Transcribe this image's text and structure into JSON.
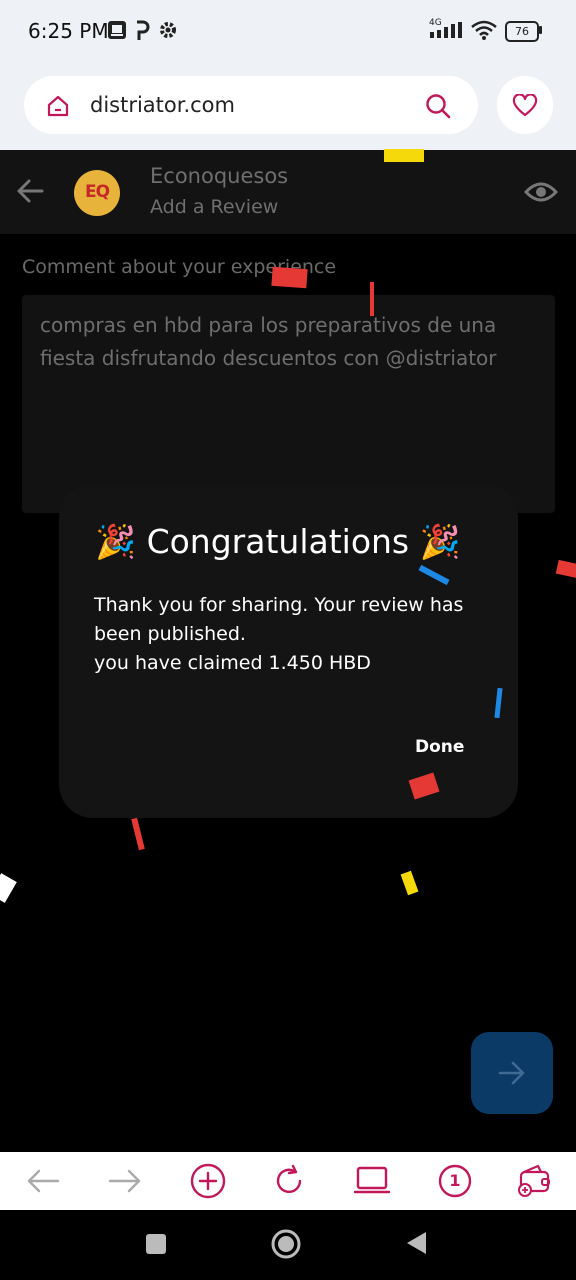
{
  "status_bar": {
    "time": "6:25 PM",
    "network_label": "4G",
    "battery": "76"
  },
  "browser": {
    "url": "distriator.com"
  },
  "app_header": {
    "logo_text": "EQ",
    "store_name": "Econoquesos",
    "subtitle": "Add a Review"
  },
  "review_form": {
    "comment_label": "Comment about your experience",
    "comment_value": "compras en hbd para los preparativos de una fiesta disfrutando descuentos con @distriator"
  },
  "dialog": {
    "title": "🎉 Congratulations 🎉",
    "message_line1": "Thank you for sharing. Your review has been published.",
    "message_line2": "you have claimed 1.450 HBD",
    "done_label": "Done"
  },
  "bottom_toolbar": {
    "tab_count": "1"
  },
  "colors": {
    "accent": "#c2185b",
    "next_button": "#0b3a66",
    "dialog_bg": "#141414"
  }
}
